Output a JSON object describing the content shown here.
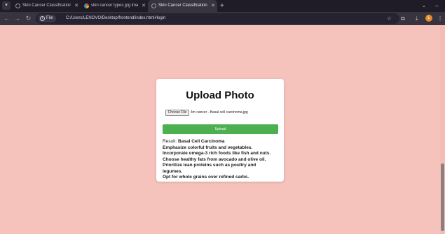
{
  "browser": {
    "tabs": [
      {
        "title": "Skin Cancer Classification",
        "active": false,
        "favicon": "globe-icon"
      },
      {
        "title": "skin cancer types jpg images",
        "active": false,
        "favicon": "google-icon"
      },
      {
        "title": "Skin Cancer Classification",
        "active": true,
        "favicon": "globe-icon"
      }
    ],
    "address": {
      "scheme_label": "File",
      "url": "C:/Users/LENOVO/Desktop/frontend/index.html#login"
    },
    "profile_initial": "L"
  },
  "page": {
    "heading": "Upload Photo",
    "file_input": {
      "button_label": "Choose File",
      "file_name": "4m cancer - Basal cell carcinoma.jpg"
    },
    "upload_button_label": "Upload",
    "result": {
      "label": "Result:",
      "diagnosis": "Basal Cell Carcinoma",
      "recommendations": [
        "Emphasize colorful fruits and vegetables.",
        "Incorporate omega-3 rich foods like fish and nuts.",
        "Choose healthy fats from avocado and olive oil.",
        "Prioritize lean proteins such as poultry and",
        "legumes.",
        "Opt for whole grains over refined carbs."
      ]
    }
  },
  "colors": {
    "page_background": "#f6c3bc",
    "card_background": "#ffffff",
    "upload_button": "#4caf50",
    "titlebar": "#1f1c27",
    "toolbar": "#37343f"
  }
}
